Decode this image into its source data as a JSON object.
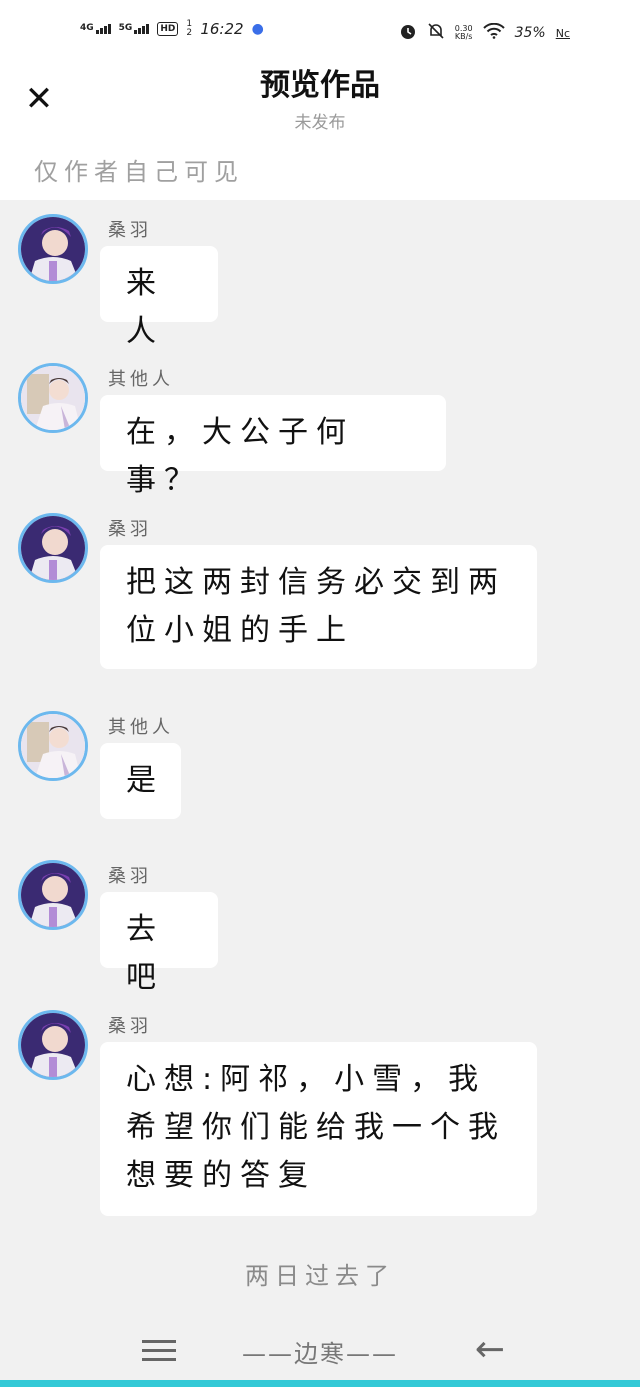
{
  "status_bar": {
    "network_1": "4G",
    "network_2": "5G",
    "hd_badge": "HD",
    "sim_digits": "1 2",
    "time": "16:22",
    "net_speed_value": "0.30",
    "net_speed_unit": "KB/s",
    "battery": "35%",
    "nfc_label": "Nc",
    "icons": [
      "signal-icon",
      "paw-icon",
      "alarm-icon",
      "bell-muted-icon",
      "wifi-icon"
    ]
  },
  "header": {
    "title": "预览作品",
    "subtitle": "未发布",
    "visibility_note": "仅作者自己可见"
  },
  "messages": [
    {
      "sender": "桑羽",
      "text": "来人"
    },
    {
      "sender": "其他人",
      "text": "在，大公子何事？"
    },
    {
      "sender": "桑羽",
      "text": "把这两封信务必交到两位小姐的手上"
    },
    {
      "sender": "其他人",
      "text": "是"
    },
    {
      "sender": "桑羽",
      "text": "去吧"
    },
    {
      "sender": "桑羽",
      "text": "心想:阿祁，小雪，我希望你们能给我一个我想要的答复"
    }
  ],
  "narration": "两日过去了",
  "nav_bar": {
    "center_text": "——边寒——"
  },
  "colors": {
    "background": "#f1f1f1",
    "bubble": "#ffffff",
    "avatar_ring": "#6cb8ee",
    "accent_strip": "#34c9d6"
  }
}
